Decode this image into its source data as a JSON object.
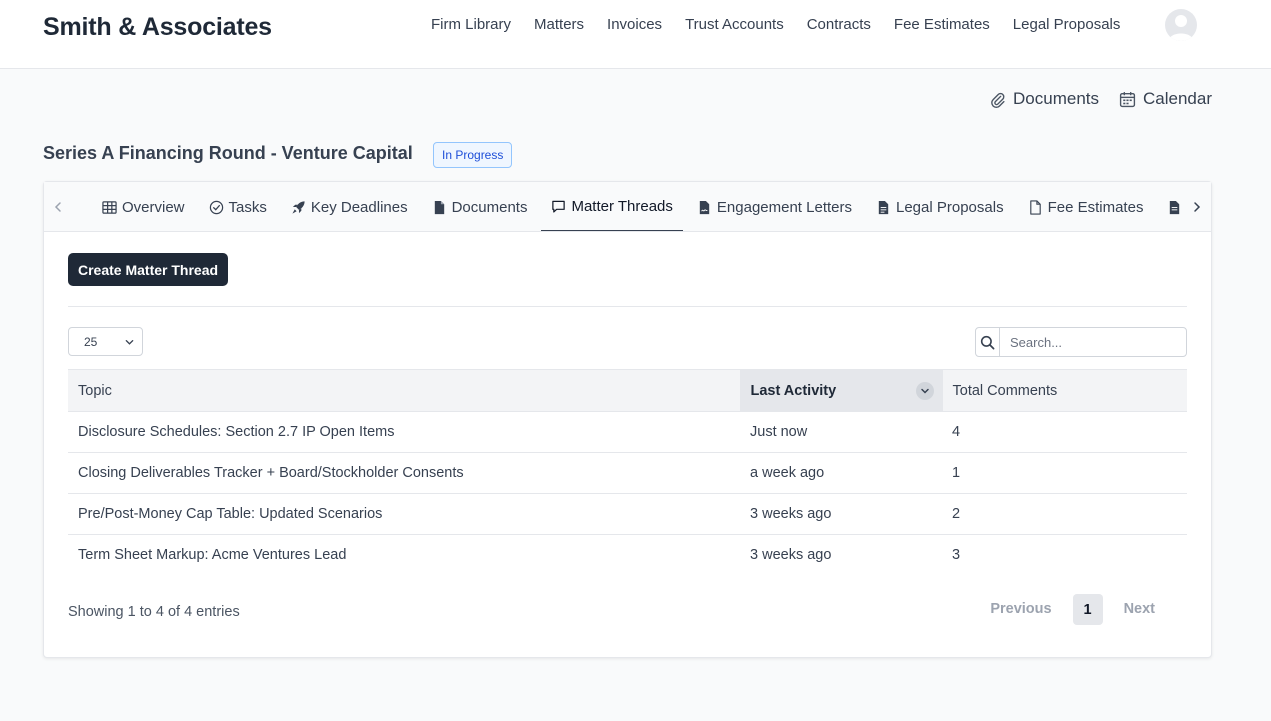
{
  "app": {
    "brand": "Smith & Associates"
  },
  "topnav": {
    "items": [
      "Firm Library",
      "Matters",
      "Invoices",
      "Trust Accounts",
      "Contracts",
      "Fee Estimates",
      "Legal Proposals"
    ]
  },
  "quick_links": {
    "documents": "Documents",
    "calendar": "Calendar"
  },
  "matter": {
    "title": "Series A Financing Round - Venture Capital",
    "status": "In Progress"
  },
  "tabs": [
    {
      "label": "Overview",
      "icon": "table-icon"
    },
    {
      "label": "Tasks",
      "icon": "check-circle-icon"
    },
    {
      "label": "Key Deadlines",
      "icon": "rocket-icon"
    },
    {
      "label": "Documents",
      "icon": "file-icon"
    },
    {
      "label": "Matter Threads",
      "icon": "comment-icon",
      "active": true
    },
    {
      "label": "Engagement Letters",
      "icon": "file-signature-icon"
    },
    {
      "label": "Legal Proposals",
      "icon": "file-lines-icon"
    },
    {
      "label": "Fee Estimates",
      "icon": "file-outline-icon"
    }
  ],
  "actions": {
    "create_label": "Create Matter Thread"
  },
  "controls": {
    "page_size": "25",
    "search_placeholder": "Search..."
  },
  "table": {
    "headers": {
      "topic": "Topic",
      "last_activity": "Last Activity",
      "total_comments": "Total Comments"
    },
    "rows": [
      {
        "topic": "Disclosure Schedules: Section 2.7 IP Open Items",
        "last_activity": "Just now",
        "total_comments": "4"
      },
      {
        "topic": "Closing Deliverables Tracker + Board/Stockholder Consents",
        "last_activity": "a week ago",
        "total_comments": "1"
      },
      {
        "topic": "Pre/Post-Money Cap Table: Updated Scenarios",
        "last_activity": "3 weeks ago",
        "total_comments": "2"
      },
      {
        "topic": "Term Sheet Markup: Acme Ventures Lead",
        "last_activity": "3 weeks ago",
        "total_comments": "3"
      }
    ]
  },
  "footer": {
    "showing": "Showing 1 to 4 of 4 entries"
  },
  "pagination": {
    "previous": "Previous",
    "current": "1",
    "next": "Next"
  },
  "colors": {
    "primary_dark": "#1f2937",
    "status_blue": "#1d4ed8",
    "border": "#e5e7eb"
  }
}
